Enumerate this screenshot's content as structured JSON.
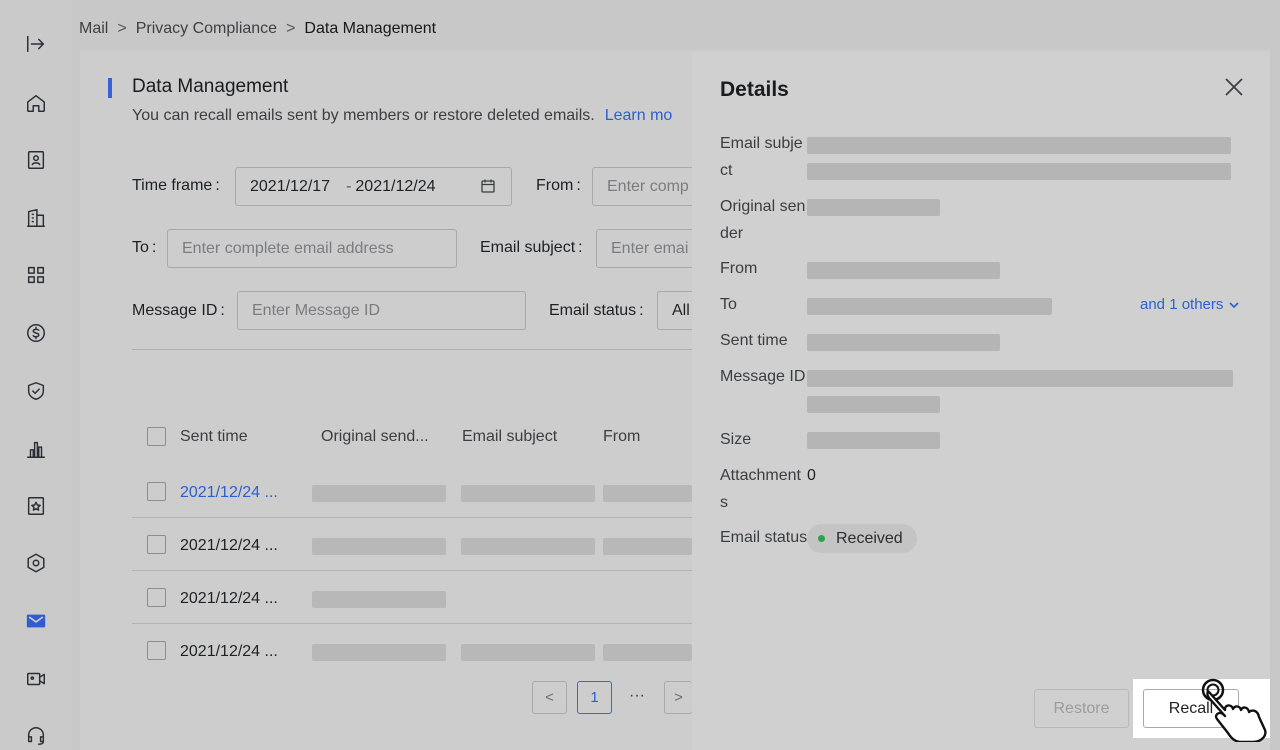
{
  "sidebar": {
    "icons": [
      "collapse-icon",
      "home-icon",
      "contacts-icon",
      "building-icon",
      "apps-grid-icon",
      "billing-icon",
      "security-shield-icon",
      "statistics-icon",
      "favorites-icon",
      "settings-icon",
      "mail-icon",
      "meeting-icon",
      "support-icon"
    ],
    "active": "mail-icon",
    "accent": "#2f5bd3"
  },
  "breadcrumb": {
    "items": [
      "Mail",
      "Privacy Compliance",
      "Data Management"
    ],
    "separator": ">"
  },
  "page": {
    "title": "Data Management",
    "description": "You can recall emails sent by members or restore deleted emails.",
    "learn_more": "Learn mo"
  },
  "filters": {
    "time_frame_label": "Time frame",
    "time_start": "2021/12/17",
    "time_sep": "-",
    "time_end": "2021/12/24",
    "from_label": "From",
    "from_placeholder": "Enter comp",
    "to_label": "To",
    "to_placeholder": "Enter complete email address",
    "subject_label": "Email subject",
    "subject_placeholder": "Enter emai",
    "message_id_label": "Message ID",
    "message_id_placeholder": "Enter Message ID",
    "status_label": "Email status",
    "status_value": "All",
    "colon": ":"
  },
  "table": {
    "headers": [
      "Sent time",
      "Original send...",
      "Email subject",
      "From"
    ],
    "rows": [
      {
        "sent_time": "2021/12/24 ..."
      },
      {
        "sent_time": "2021/12/24 ..."
      },
      {
        "sent_time": "2021/12/24 ..."
      },
      {
        "sent_time": "2021/12/24 ..."
      }
    ]
  },
  "pagination": {
    "prev": "<",
    "current": "1",
    "ellipsis": "···",
    "next": ">"
  },
  "details": {
    "title": "Details",
    "labels": {
      "subject": "Email subject",
      "original_sender": "Original sender",
      "from": "From",
      "to": "To",
      "sent_time": "Sent time",
      "message_id": "Message ID",
      "size": "Size",
      "attachments": "Attachments",
      "status": "Email status"
    },
    "attachments_value": "0",
    "to_more": "and 1 others",
    "status_value": "Received",
    "status_color": "#2aa34a",
    "restore_label": "Restore",
    "recall_label": "Recall"
  }
}
